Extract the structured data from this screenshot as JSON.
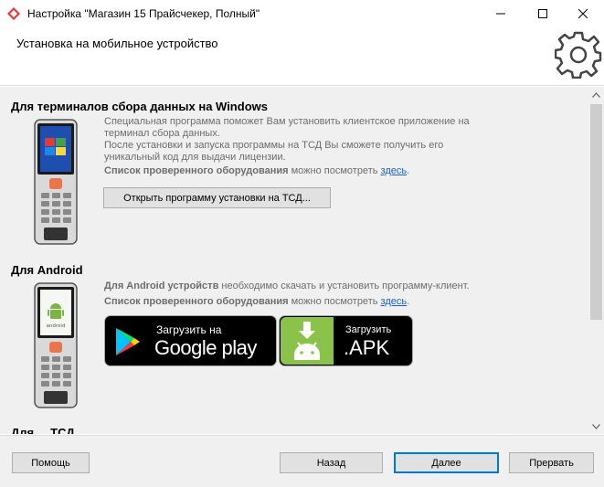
{
  "window": {
    "title": "Настройка \"Магазин 15 Прайсчекер, Полный\""
  },
  "header": {
    "title": "Установка на мобильное устройство",
    "icon": "gear-icon"
  },
  "windows_section": {
    "title": "Для терминалов сбора данных на Windows",
    "line1": "Специальная программа поможет Вам установить клиентское приложение на терминал сбора данных.",
    "line2": "После установки и запуска программы на ТСД Вы сможете получить его уникальный код для выдачи лицензии.",
    "hw_bold": "Список проверенного оборудования",
    "hw_text": " можно посмотреть ",
    "hw_link": "здесь",
    "hw_end": ".",
    "button": "Открыть программу установки на ТСД..."
  },
  "android_section": {
    "title": "Для Android",
    "line_bold": "Для Android устройств",
    "line_text": " необходимо скачать и установить программу-клиент.",
    "hw_bold": "Список проверенного оборудования",
    "hw_text": " можно посмотреть ",
    "hw_link": "здесь",
    "hw_end": ".",
    "gp_small": "Загрузить на",
    "gp_big": "Google play",
    "apk_small": "Загрузить",
    "apk_big": ".APK",
    "device_text": "android"
  },
  "next_section": {
    "title_partial": "Для ... ТСД"
  },
  "footer": {
    "help": "Помощь",
    "back": "Назад",
    "next": "Далее",
    "cancel": "Прервать"
  }
}
